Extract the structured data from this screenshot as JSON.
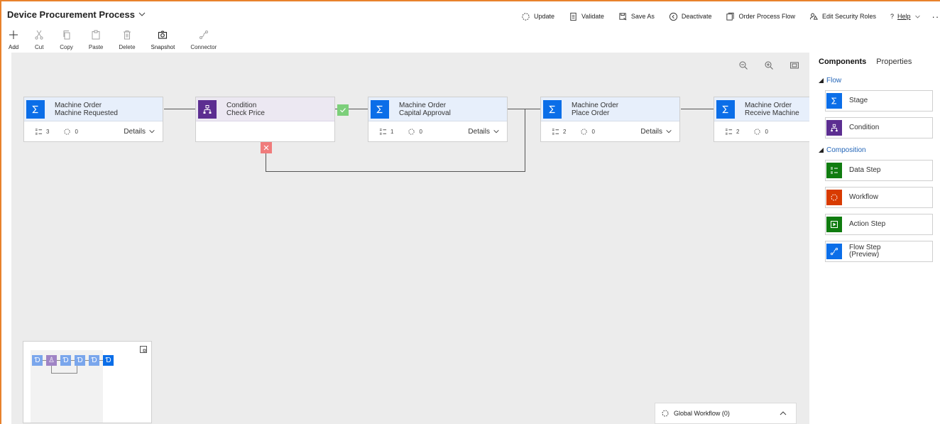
{
  "header": {
    "title": "Device Procurement Process",
    "commands": [
      {
        "label": "Update",
        "icon": "update-icon"
      },
      {
        "label": "Validate",
        "icon": "validate-icon"
      },
      {
        "label": "Save As",
        "icon": "save-as-icon"
      },
      {
        "label": "Deactivate",
        "icon": "deactivate-icon"
      },
      {
        "label": "Order Process Flow",
        "icon": "order-icon"
      },
      {
        "label": "Edit Security Roles",
        "icon": "security-roles-icon"
      },
      {
        "label": "Help",
        "icon": "help-icon"
      }
    ],
    "more": "···"
  },
  "toolbar": {
    "add": "Add",
    "cut": "Cut",
    "copy": "Copy",
    "paste": "Paste",
    "delete": "Delete",
    "snapshot": "Snapshot",
    "connector": "Connector"
  },
  "canvas": {
    "nodes": [
      {
        "type": "stage",
        "line1": "Machine Order",
        "line2": "Machine Requested",
        "steps": "3",
        "workflows": "0",
        "details": "Details"
      },
      {
        "type": "condition",
        "line1": "Condition",
        "line2": "Check Price"
      },
      {
        "type": "stage",
        "line1": "Machine Order",
        "line2": "Capital Approval",
        "steps": "1",
        "workflows": "0",
        "details": "Details"
      },
      {
        "type": "stage",
        "line1": "Machine Order",
        "line2": "Place Order",
        "steps": "2",
        "workflows": "0",
        "details": "Details"
      },
      {
        "type": "stage",
        "line1": "Machine Order",
        "line2": "Receive Machine",
        "steps": "2",
        "workflows": "0"
      }
    ],
    "global_workflow": "Global Workflow (0)"
  },
  "panel": {
    "tabs": [
      "Components",
      "Properties"
    ],
    "flow_section": "Flow",
    "flow_items": [
      {
        "label": "Stage",
        "color": "#0b6ee8"
      },
      {
        "label": "Condition",
        "color": "#5c2e91"
      }
    ],
    "composition_section": "Composition",
    "composition_items": [
      {
        "label": "Data Step",
        "color": "#107c10"
      },
      {
        "label": "Workflow",
        "color": "#d83b01"
      },
      {
        "label": "Action Step",
        "color": "#107c10"
      },
      {
        "label1": "Flow Step",
        "label2": "(Preview)",
        "color": "#0b6ee8"
      }
    ]
  },
  "colors": {
    "accent_border": "#e8822c",
    "stage": "#0b6ee8",
    "condition": "#5c2e91",
    "yes_badge": "#7ccf7a",
    "no_badge": "#f07c7c"
  }
}
